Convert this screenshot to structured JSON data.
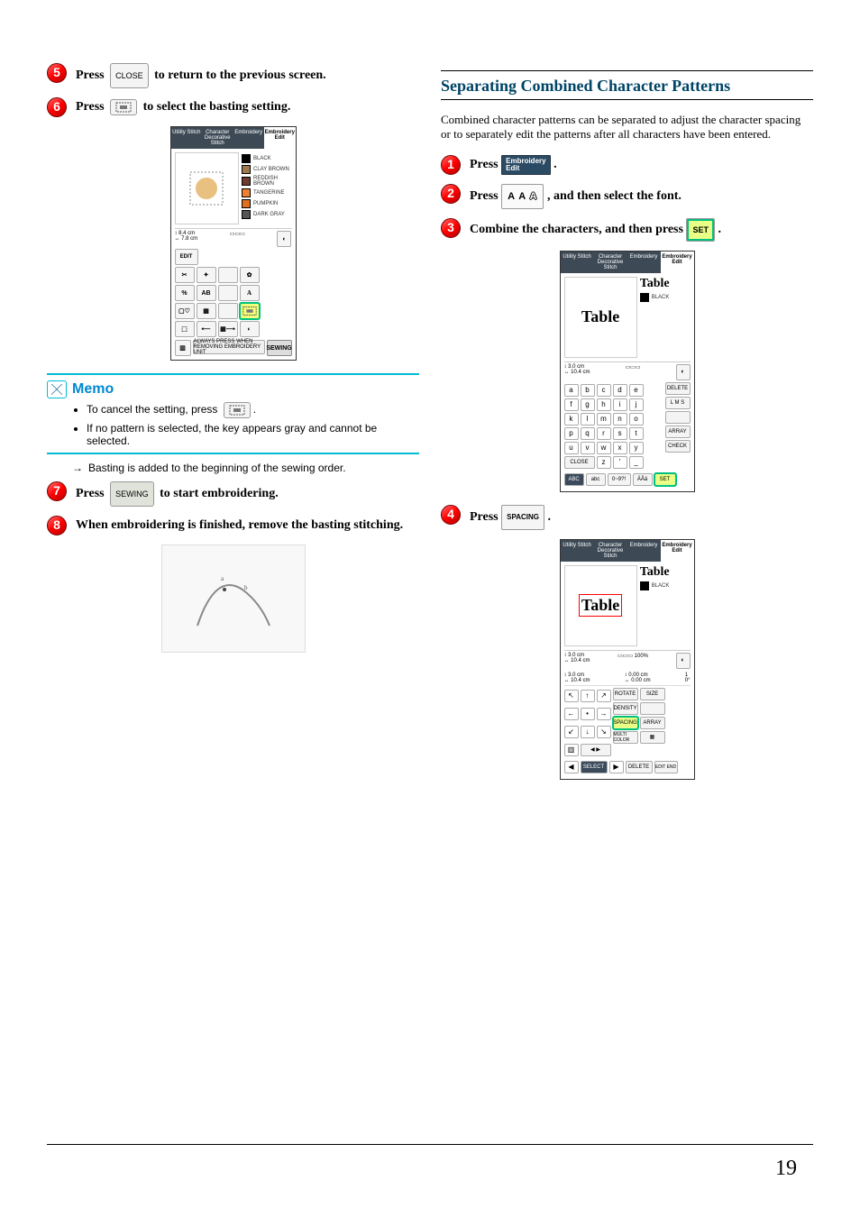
{
  "page_number": "19",
  "left": {
    "step5": {
      "prefix": "Press ",
      "btn": "CLOSE",
      "suffix": " to return to the previous screen."
    },
    "step6": {
      "prefix": "Press ",
      "btn_icon": "basting-icon",
      "suffix": " to select the basting setting."
    },
    "panel1": {
      "tabs": [
        "Utility Stitch",
        "Character Decorative Stitch",
        "Embroidery",
        "Embroidery Edit"
      ],
      "active_tab": 3,
      "legend": [
        {
          "name": "BLACK",
          "color": "#000000"
        },
        {
          "name": "CLAY BROWN",
          "color": "#a07850"
        },
        {
          "name": "REDDISH BROWN",
          "color": "#6d3b2f"
        },
        {
          "name": "TANGERINE",
          "color": "#f08030"
        },
        {
          "name": "PUMPKIN",
          "color": "#e07020"
        },
        {
          "name": "DARK GRAY",
          "color": "#555555"
        }
      ],
      "dims": {
        "h": "8.4 cm",
        "w": "7.8 cm"
      },
      "edit_label": "EDIT",
      "group_label": "AB",
      "group_label2": "A",
      "note": "ALWAYS PRESS WHEN REMOVING EMBROIDERY UNIT",
      "sewing": "SEWING"
    },
    "memo": {
      "title": "Memo",
      "items": [
        "To cancel the setting, press ",
        "If no pattern is selected, the key appears gray and cannot be selected."
      ],
      "cancel_btn_icon": "basting-icon"
    },
    "note_arrow": "→",
    "note_text": "Basting is added to the beginning of the sewing order.",
    "step7": {
      "prefix": "Press ",
      "btn": "SEWING",
      "suffix": " to start embroidering."
    },
    "step8": "When embroidering is finished, remove the basting stitching.",
    "photo": "(fabric photo)"
  },
  "right": {
    "heading": "Separating Combined Character Patterns",
    "intro": "Combined character patterns can be separated to adjust the character spacing or to separately edit the patterns after all characters have been entered.",
    "step1": {
      "prefix": "Press ",
      "btn_top": "Embroidery",
      "btn_bottom": "Edit",
      "suffix": "."
    },
    "step2": {
      "prefix": "Press ",
      "btn": "A A",
      "btn_outline": "A",
      "suffix": ", and then select the font."
    },
    "step3": {
      "prefix": "Combine the characters, and then press ",
      "btn": "SET",
      "suffix": "."
    },
    "panel3": {
      "tabs": [
        "Utility Stitch",
        "Character Decorative Stitch",
        "Embroidery",
        "Embroidery Edit"
      ],
      "active_tab": 3,
      "sample": "Table",
      "side_sample": "Table",
      "side_color": "BLACK",
      "dims": {
        "h": "3.0 cm",
        "w": "10.4 cm"
      },
      "keys": [
        [
          "a",
          "b",
          "c",
          "d",
          "e"
        ],
        [
          "f",
          "g",
          "h",
          "i",
          "j"
        ],
        [
          "k",
          "l",
          "m",
          "n",
          "o"
        ],
        [
          "p",
          "q",
          "r",
          "s",
          "t"
        ],
        [
          "u",
          "v",
          "w",
          "x",
          "y"
        ]
      ],
      "close": "CLOSE",
      "z": "z",
      "side_btns": [
        "DELETE",
        "L M S",
        "",
        "ARRAY",
        "CHECK"
      ],
      "bottom": [
        "ABC",
        "abc",
        "0~9?!",
        "ÄÅä"
      ],
      "set": "SET"
    },
    "step4": {
      "prefix": "Press ",
      "btn": "SPACING",
      "suffix": "."
    },
    "panel4": {
      "tabs": [
        "Utility Stitch",
        "Character Decorative Stitch",
        "Embroidery",
        "Embroidery Edit"
      ],
      "active_tab": 3,
      "sample": "Table",
      "side_sample": "Table",
      "side_color": "BLACK",
      "dims": {
        "h": "3.0 cm",
        "w": "10.4 cm"
      },
      "scale": "100%",
      "info": {
        "h": "3.0 cm",
        "w": "10.4 cm",
        "dx": "0.00 cm",
        "dy": "0.00 cm",
        "n": "1",
        "deg": "0°"
      },
      "grid": [
        [
          "↖",
          "↑",
          "↗",
          "ROTATE",
          "SIZE"
        ],
        [
          "←",
          "•",
          "→",
          "DENSITY",
          ""
        ],
        [
          "↙",
          "↓",
          "↘",
          "SPACING",
          "ARRAY"
        ],
        [
          "",
          "",
          "",
          "MULTI COLOR",
          ""
        ]
      ],
      "spacing_hl_row": 2,
      "spacing_hl_col": 3,
      "bottom": {
        "select": "SELECT",
        "delete": "DELETE",
        "editend": "EDIT END"
      }
    }
  }
}
